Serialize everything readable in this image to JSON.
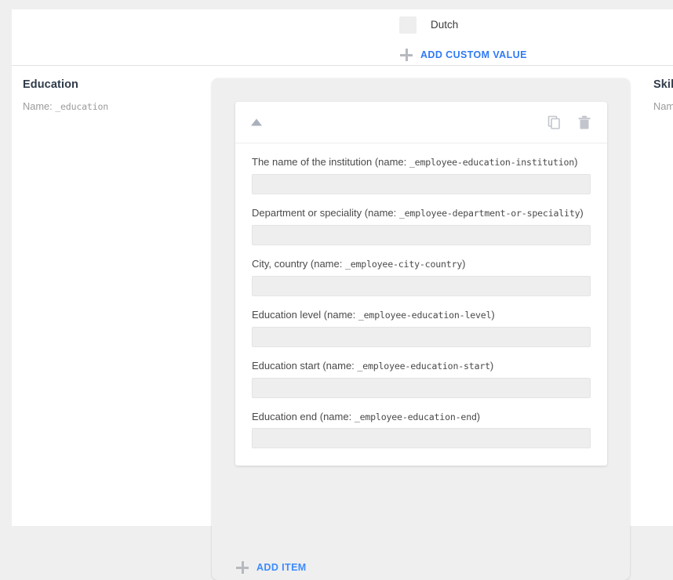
{
  "top_panel": {
    "option_row": {
      "label": "Dutch",
      "checked": false
    },
    "add_custom_value_label": "ADD CUSTOM VALUE"
  },
  "groups": {
    "education": {
      "title": "Education",
      "name_line_prefix": "Name: ",
      "name_line_value": "_education"
    },
    "skills": {
      "title": "Skil",
      "name_line_prefix": "Nam",
      "name_line_value": ""
    }
  },
  "array_item": {
    "collapse_icon": "triangle-up-icon",
    "duplicate_icon": "copy-icon",
    "delete_icon": "trash-icon",
    "fields": [
      {
        "label_text": "The name of the institution (name: ",
        "label_name": "_employee-education-institution",
        "label_suffix": ")",
        "value": "",
        "placeholder": ""
      },
      {
        "label_text": "Department or speciality (name: ",
        "label_name": "_employee-department-or-speciality",
        "label_suffix": ")",
        "value": "",
        "placeholder": ""
      },
      {
        "label_text": "City, country (name: ",
        "label_name": "_employee-city-country",
        "label_suffix": ")",
        "value": "",
        "placeholder": ""
      },
      {
        "label_text": "Education level (name: ",
        "label_name": "_employee-education-level",
        "label_suffix": ")",
        "value": "",
        "placeholder": ""
      },
      {
        "label_text": "Education start (name: ",
        "label_name": "_employee-education-start",
        "label_suffix": ")",
        "value": "",
        "placeholder": ""
      },
      {
        "label_text": "Education end (name: ",
        "label_name": "_employee-education-end",
        "label_suffix": ")",
        "value": "",
        "placeholder": ""
      }
    ]
  },
  "add_item_label": "ADD ITEM",
  "colors": {
    "link_blue": "#2f7af5",
    "link_blue_soft": "#3d8bfd",
    "page_background": "#efefef",
    "panel_background": "#ffffff",
    "input_background": "#eeeeee",
    "icon_gray": "#b6b9be",
    "caret_gray": "#aab1bd",
    "muted_text": "#9b9b9b",
    "title_text": "#303b4a"
  }
}
